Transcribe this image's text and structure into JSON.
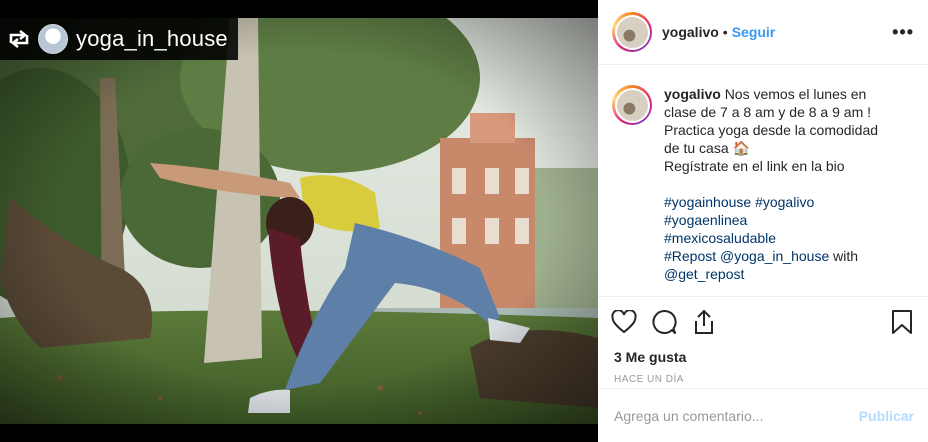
{
  "repost": {
    "username": "yoga_in_house"
  },
  "header": {
    "username": "yogalivo",
    "separator": "•",
    "follow_label": "Seguir",
    "more_label": "•••"
  },
  "caption": {
    "username": "yogalivo",
    "lines": [
      "Nos vemos el lunes en",
      "clase de 7 a 8 am y de 8 a 9 am !",
      "Practica yoga desde la comodidad",
      "de tu casa 🏠",
      "Regístrate en el link en la bio"
    ],
    "hashtags_line1": "#yogainhouse #yogalivo",
    "hashtags_line2": "#yogaenlinea",
    "hashtags_line3": "#mexicosaludable",
    "repost_tag": "#Repost",
    "repost_mention": "@yoga_in_house",
    "repost_with": "with",
    "repost_app": "@get_repost"
  },
  "actions": {
    "like_icon": "heart-icon",
    "comment_icon": "comment-bubble-icon",
    "share_icon": "share-icon",
    "save_icon": "bookmark-icon"
  },
  "likes": "3 Me gusta",
  "timestamp": "HACE UN DÍA",
  "comment_box": {
    "placeholder": "Agrega un comentario...",
    "publish_label": "Publicar"
  },
  "colors": {
    "link_blue": "#3897f0",
    "hashtag_blue": "#003569",
    "publish_disabled": "#b3dbff"
  }
}
